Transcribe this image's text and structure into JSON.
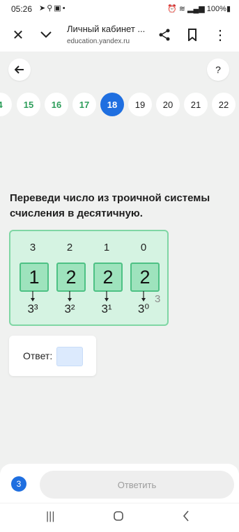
{
  "status_bar": {
    "time": "05:26",
    "left_icons": [
      "navigation-icon",
      "search-icon",
      "gallery-icon",
      "dot-icon"
    ],
    "battery": "100%"
  },
  "browser": {
    "page_title": "Личный кабинет ...",
    "url": "education.yandex.ru",
    "icons": [
      "close-icon",
      "chevron-down-icon",
      "share-icon",
      "bookmark-icon",
      "more-icon"
    ]
  },
  "top_controls": {
    "back_icon": "arrow-left-icon",
    "help_label": "?"
  },
  "question_nav": {
    "items": [
      {
        "label": "4",
        "state": "done"
      },
      {
        "label": "15",
        "state": "done"
      },
      {
        "label": "16",
        "state": "done"
      },
      {
        "label": "17",
        "state": "done"
      },
      {
        "label": "18",
        "state": "current"
      },
      {
        "label": "19",
        "state": "todo"
      },
      {
        "label": "20",
        "state": "todo"
      },
      {
        "label": "21",
        "state": "todo"
      },
      {
        "label": "22",
        "state": "todo"
      }
    ]
  },
  "task": {
    "prompt": "Переведи число из троичной системы счисления в десятичную.",
    "positions": [
      "3",
      "2",
      "1",
      "0"
    ],
    "digits": [
      "1",
      "2",
      "2",
      "2"
    ],
    "powers": [
      "3³",
      "3²",
      "3¹",
      "3⁰"
    ],
    "base": "3"
  },
  "answer": {
    "label": "Ответ:",
    "value": ""
  },
  "footer": {
    "badge_count": "3",
    "submit_label": "Ответить"
  },
  "colors": {
    "accent_blue": "#1f6fe0",
    "done_green": "#2e9e5b",
    "task_bg": "#d5f3e2",
    "digit_bg": "#9ee3bd"
  }
}
